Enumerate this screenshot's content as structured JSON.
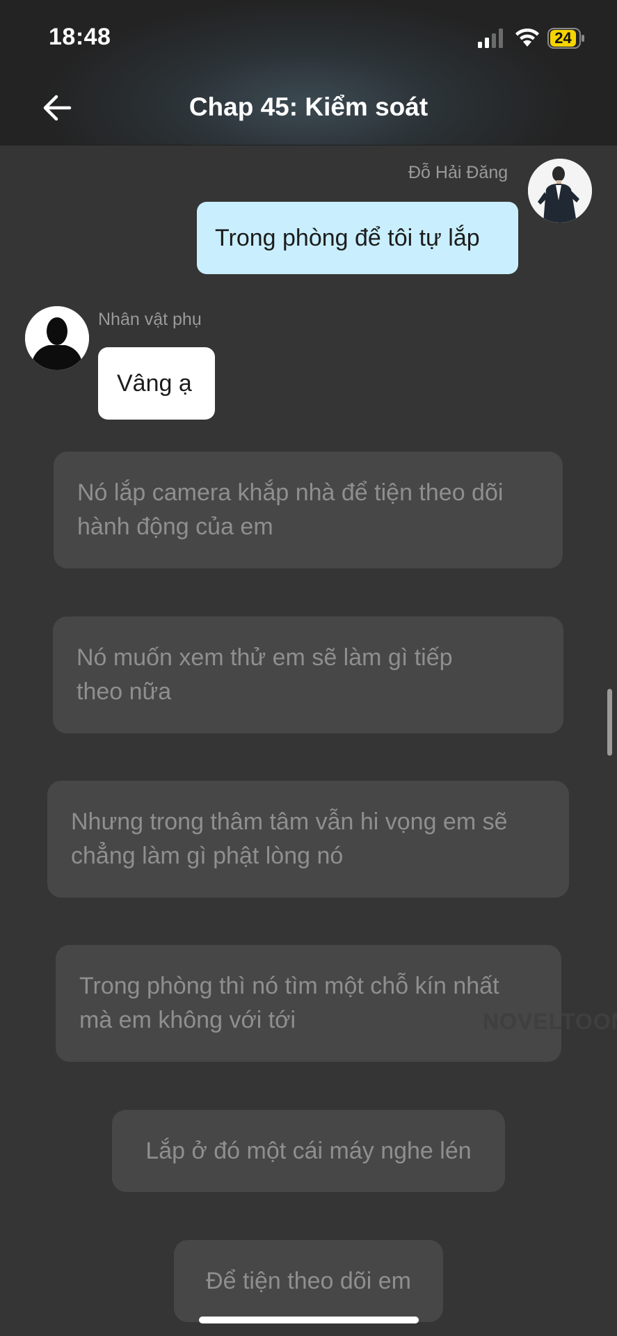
{
  "status_bar": {
    "time": "18:48",
    "battery": "24",
    "signal_icon": "cellular-signal-icon",
    "wifi_icon": "wifi-icon",
    "battery_icon": "battery-icon"
  },
  "header": {
    "title": "Chap 45: Kiểm soát",
    "back_icon": "arrow-left-icon"
  },
  "messages": [
    {
      "sender": "Đỗ Hải Đăng",
      "side": "right",
      "text": "Trong phòng để tôi tự lắp",
      "bubble_color": "#c9efff"
    },
    {
      "sender": "Nhân vật phụ",
      "side": "left",
      "text": "Vâng ạ",
      "bubble_color": "#ffffff"
    }
  ],
  "narration": [
    {
      "line1": "Nó lắp camera khắp nhà để tiện theo dõi",
      "line2": "hành động của em"
    },
    {
      "line1": "Nó muốn xem thử em sẽ làm gì tiếp",
      "line2": "theo nữa"
    },
    {
      "line1": "Nhưng trong thâm tâm vẫn hi vọng em sẽ",
      "line2": "chẳng làm gì phật lòng nó"
    },
    {
      "line1": "Trong phòng thì nó tìm một chỗ kín nhất",
      "line2": "mà em không với tới"
    },
    {
      "text": "Lắp ở đó một cái máy nghe lén"
    },
    {
      "text": "Để tiện theo dõi em"
    }
  ],
  "watermark": "NOVELTOON",
  "colors": {
    "background": "#353535",
    "narration_bubble": "#474747",
    "narration_text": "#8f8f8f",
    "outgoing_bubble": "#c9efff",
    "incoming_bubble": "#ffffff"
  }
}
